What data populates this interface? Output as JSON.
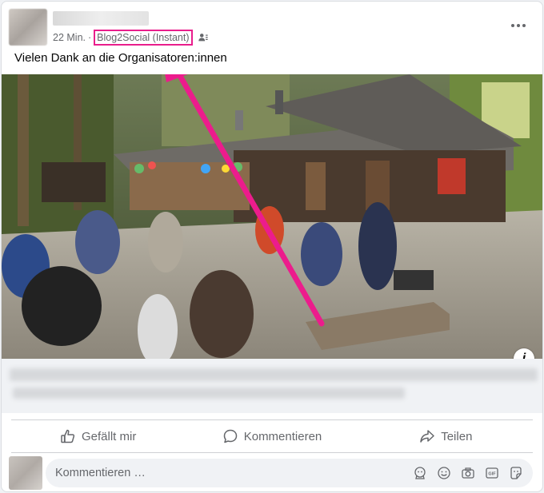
{
  "post": {
    "time": "22 Min.",
    "separator": "·",
    "source": "Blog2Social (Instant)",
    "text": "Vielen Dank an die Organisatoren:innen",
    "more_icon": "more-horizontal-icon",
    "audience_icon": "friends-icon"
  },
  "photo": {
    "info_label": "i"
  },
  "actions": {
    "like": "Gefällt mir",
    "comment": "Kommentieren",
    "share": "Teilen"
  },
  "comment_box": {
    "placeholder": "Kommentieren …",
    "icons": [
      "avatar-sticker-icon",
      "emoji-icon",
      "camera-icon",
      "gif-icon",
      "sticker-icon"
    ]
  },
  "colors": {
    "highlight": "#e91e8c",
    "secondary_text": "#65676b",
    "divider": "#ced0d4"
  }
}
